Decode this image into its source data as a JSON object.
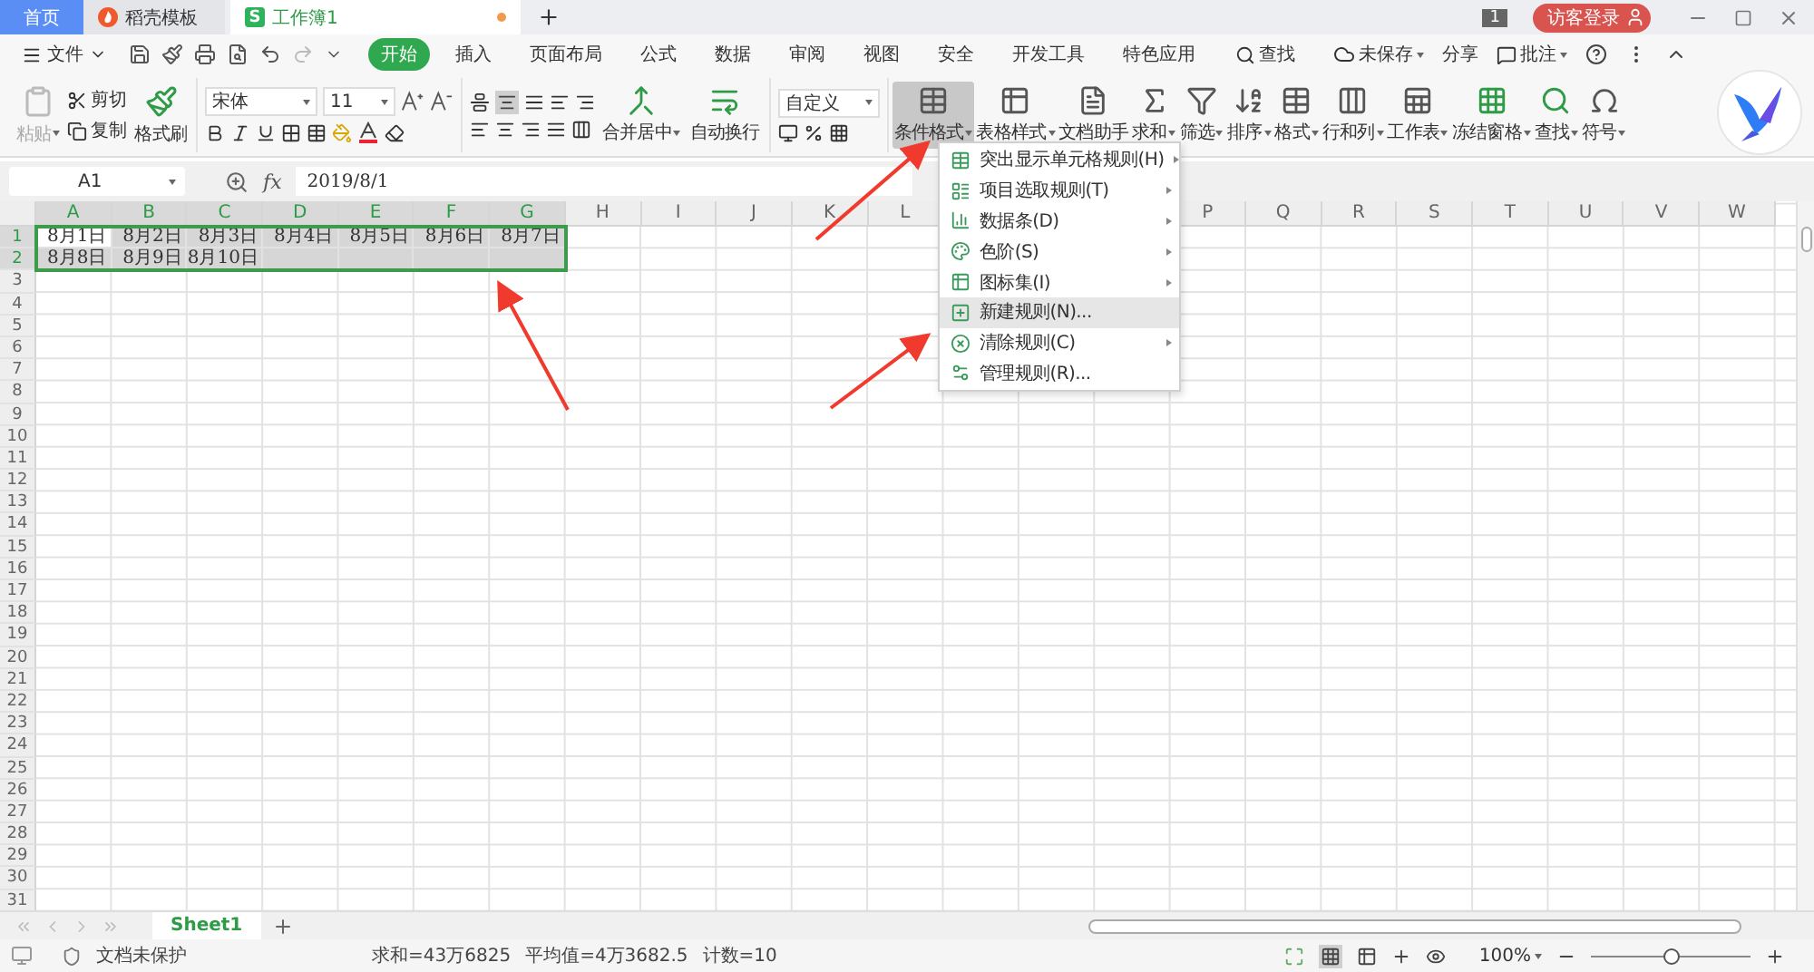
{
  "doc_tabs": [
    {
      "kind": "home",
      "label": "首页",
      "selected": false,
      "modified": false
    },
    {
      "kind": "template",
      "label": "稻壳模板",
      "selected": false,
      "modified": false
    },
    {
      "kind": "sheet",
      "label": "工作簿1",
      "icon_text": "S",
      "selected": true,
      "modified": true
    }
  ],
  "title_bar": {
    "window_count": "1",
    "login": "访客登录"
  },
  "menu": {
    "file": "文件",
    "tabs": [
      {
        "label": "开始",
        "selected": true
      },
      {
        "label": "插入",
        "selected": false
      },
      {
        "label": "页面布局",
        "selected": false
      },
      {
        "label": "公式",
        "selected": false
      },
      {
        "label": "数据",
        "selected": false
      },
      {
        "label": "审阅",
        "selected": false
      },
      {
        "label": "视图",
        "selected": false
      },
      {
        "label": "安全",
        "selected": false
      },
      {
        "label": "开发工具",
        "selected": false
      },
      {
        "label": "特色应用",
        "selected": false
      }
    ],
    "search": "查找",
    "unsaved": "未保存",
    "share": "分享",
    "comment": "批注"
  },
  "ribbon": {
    "paste": {
      "label": "粘贴",
      "disabled": true
    },
    "cut": "剪切",
    "copy": "复制",
    "format_painter": "格式刷",
    "font_name": "宋体",
    "font_size": "11",
    "merge": "合并居中",
    "wrap": "自动换行",
    "number_format": "自定义",
    "tools": [
      {
        "kind": "conditional",
        "label": "条件格式",
        "dropdown": true,
        "selected": true
      },
      {
        "kind": "table_style",
        "label": "表格样式",
        "dropdown": true,
        "selected": false
      },
      {
        "kind": "assistant",
        "label": "文档助手",
        "dropdown": false,
        "selected": false
      },
      {
        "kind": "sum",
        "label": "求和",
        "dropdown": true,
        "selected": false
      },
      {
        "kind": "filter",
        "label": "筛选",
        "dropdown": true,
        "selected": false
      },
      {
        "kind": "sort",
        "label": "排序",
        "dropdown": true,
        "selected": false
      },
      {
        "kind": "format",
        "label": "格式",
        "dropdown": true,
        "selected": false
      },
      {
        "kind": "rowcol",
        "label": "行和列",
        "dropdown": true,
        "selected": false
      },
      {
        "kind": "sheet",
        "label": "工作表",
        "dropdown": true,
        "selected": false
      },
      {
        "kind": "freeze",
        "label": "冻结窗格",
        "dropdown": true,
        "selected": false
      },
      {
        "kind": "find",
        "label": "查找",
        "dropdown": true,
        "selected": false
      },
      {
        "kind": "symbol",
        "label": "符号",
        "dropdown": true,
        "selected": false
      }
    ]
  },
  "formula_bar": {
    "cell_ref": "A1",
    "fx": "fx",
    "value": "2019/8/1"
  },
  "grid": {
    "columns": [
      {
        "label": "A",
        "selected": true
      },
      {
        "label": "B",
        "selected": true
      },
      {
        "label": "C",
        "selected": true
      },
      {
        "label": "D",
        "selected": true
      },
      {
        "label": "E",
        "selected": true
      },
      {
        "label": "F",
        "selected": true
      },
      {
        "label": "G",
        "selected": true
      },
      {
        "label": "H",
        "selected": false
      },
      {
        "label": "I",
        "selected": false
      },
      {
        "label": "J",
        "selected": false
      },
      {
        "label": "K",
        "selected": false
      },
      {
        "label": "L",
        "selected": false
      },
      {},
      {},
      {},
      {
        "label": "P",
        "selected": false
      },
      {
        "label": "Q",
        "selected": false
      },
      {
        "label": "R",
        "selected": false
      },
      {
        "label": "S",
        "selected": false
      },
      {
        "label": "T",
        "selected": false
      },
      {
        "label": "U",
        "selected": false
      },
      {
        "label": "V",
        "selected": false
      },
      {
        "label": "W",
        "selected": false
      }
    ],
    "rows": [
      {
        "label": "1",
        "selected": true,
        "cells": [
          {
            "text": "8月1日",
            "active": true
          },
          {
            "text": "8月2日",
            "active": false
          },
          {
            "text": "8月3日",
            "active": false
          },
          {
            "text": "8月4日",
            "active": false
          },
          {
            "text": "8月5日",
            "active": false
          },
          {
            "text": "8月6日",
            "active": false
          },
          {
            "text": "8月7日",
            "active": false
          }
        ]
      },
      {
        "label": "2",
        "selected": true,
        "cells": [
          {
            "text": "8月8日",
            "active": false
          },
          {
            "text": "8月9日",
            "active": false
          },
          {
            "text": "8月10日",
            "active": false
          }
        ]
      },
      {
        "label": "3",
        "selected": false
      },
      {
        "label": "4",
        "selected": false
      },
      {
        "label": "5",
        "selected": false
      },
      {
        "label": "6",
        "selected": false
      },
      {
        "label": "7",
        "selected": false
      },
      {
        "label": "8",
        "selected": false
      },
      {
        "label": "9",
        "selected": false
      },
      {
        "label": "10",
        "selected": false
      },
      {
        "label": "11",
        "selected": false
      },
      {
        "label": "12",
        "selected": false
      },
      {
        "label": "13",
        "selected": false
      },
      {
        "label": "14",
        "selected": false
      },
      {
        "label": "15",
        "selected": false
      },
      {
        "label": "16",
        "selected": false
      },
      {
        "label": "17",
        "selected": false
      },
      {
        "label": "18",
        "selected": false
      },
      {
        "label": "19",
        "selected": false
      },
      {
        "label": "20",
        "selected": false
      },
      {
        "label": "21",
        "selected": false
      },
      {
        "label": "22",
        "selected": false
      },
      {
        "label": "23",
        "selected": false
      },
      {
        "label": "24",
        "selected": false
      },
      {
        "label": "25",
        "selected": false
      },
      {
        "label": "26",
        "selected": false
      },
      {
        "label": "27",
        "selected": false
      },
      {
        "label": "28",
        "selected": false
      },
      {
        "label": "29",
        "selected": false
      },
      {
        "label": "30",
        "selected": false
      },
      {
        "label": "31",
        "selected": false
      }
    ]
  },
  "dropdown_menu": [
    {
      "kind": "highlight",
      "label": "突出显示单元格规则(H)",
      "submenu": true,
      "selected": false
    },
    {
      "kind": "topbottom",
      "label": "项目选取规则(T)",
      "submenu": true,
      "selected": false
    },
    {
      "kind": "databar",
      "label": "数据条(D)",
      "submenu": true,
      "selected": false
    },
    {
      "kind": "colorscale",
      "label": "色阶(S)",
      "submenu": true,
      "selected": false
    },
    {
      "kind": "iconset",
      "label": "图标集(I)",
      "submenu": true,
      "selected": false
    },
    {
      "kind": "new",
      "label": "新建规则(N)...",
      "submenu": false,
      "selected": true
    },
    {
      "kind": "clear",
      "label": "清除规则(C)",
      "submenu": true,
      "selected": false
    },
    {
      "kind": "manage",
      "label": "管理规则(R)...",
      "submenu": false,
      "selected": false
    }
  ],
  "sheet_tabs": [
    {
      "label": "Sheet1",
      "selected": true
    }
  ],
  "status_bar": {
    "protection": "文档未保护",
    "sum": "求和=43万6825",
    "average": "平均值=4万3682.5",
    "count": "计数=10",
    "zoom": "100%",
    "zoom_slider": {
      "level": 0.5
    }
  }
}
